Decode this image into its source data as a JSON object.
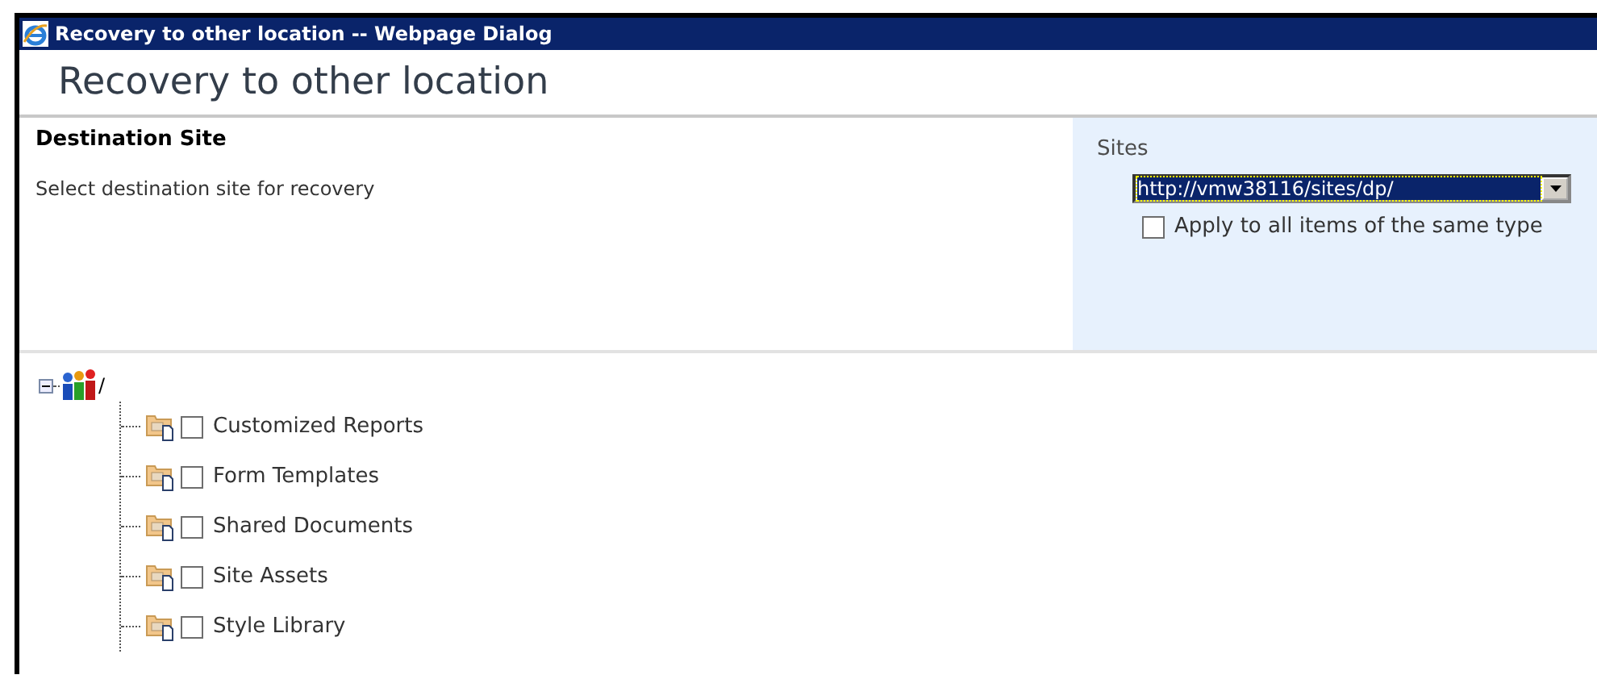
{
  "window": {
    "title": "Recovery to other location -- Webpage Dialog"
  },
  "heading": "Recovery to other location",
  "section": {
    "title": "Destination Site",
    "description": "Select destination site for recovery"
  },
  "sites": {
    "label": "Sites",
    "value": "http://vmw38116/sites/dp/",
    "apply_all": {
      "label": "Apply to all items of the same type",
      "checked": false
    }
  },
  "tree": {
    "label": "/",
    "expanded": true,
    "children": [
      {
        "label": "Customized Reports",
        "checked": false
      },
      {
        "label": "Form Templates",
        "checked": false
      },
      {
        "label": "Shared Documents",
        "checked": false
      },
      {
        "label": "Site Assets",
        "checked": false
      },
      {
        "label": "Style Library",
        "checked": false
      }
    ]
  }
}
